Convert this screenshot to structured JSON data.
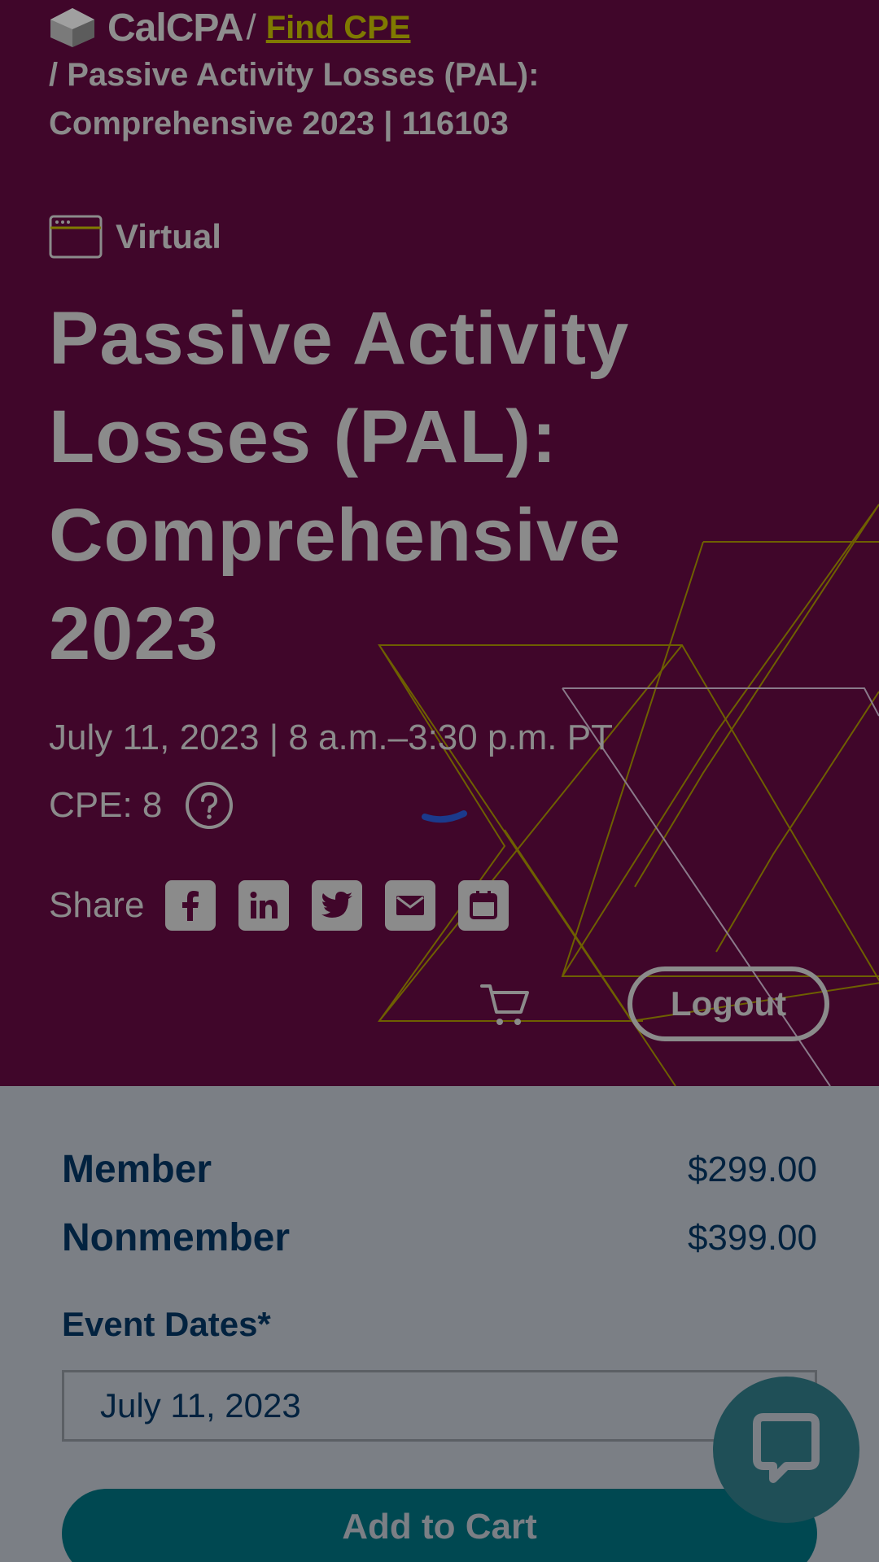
{
  "breadcrumb": {
    "brand": "CalCPA",
    "separator": "/",
    "link_label": "Find CPE",
    "current": "/ Passive Activity Losses (PAL): Comprehensive 2023 | 116103"
  },
  "event": {
    "format": "Virtual",
    "title": "Passive Activity Losses (PAL): Comprehensive 2023",
    "date_time": "July 11, 2023 | 8 a.m.–3:30 p.m. PT",
    "cpe": "CPE: 8"
  },
  "share": {
    "label": "Share",
    "icons": [
      "facebook-icon",
      "linkedin-icon",
      "twitter-icon",
      "email-icon",
      "calendar-icon"
    ]
  },
  "header_actions": {
    "logout_label": "Logout"
  },
  "pricing": {
    "member_label": "Member",
    "member_price": "$299.00",
    "nonmember_label": "Nonmember",
    "nonmember_price": "$399.00"
  },
  "event_dates": {
    "label": "Event Dates*",
    "selected": "July 11, 2023"
  },
  "add_to_cart_label": "Add to Cart",
  "colors": {
    "hero_bg": "#40062a",
    "panel_bg": "#7b7f85",
    "link": "#7f7a00",
    "text_dark": "#02223f",
    "button_teal": "#004851"
  }
}
